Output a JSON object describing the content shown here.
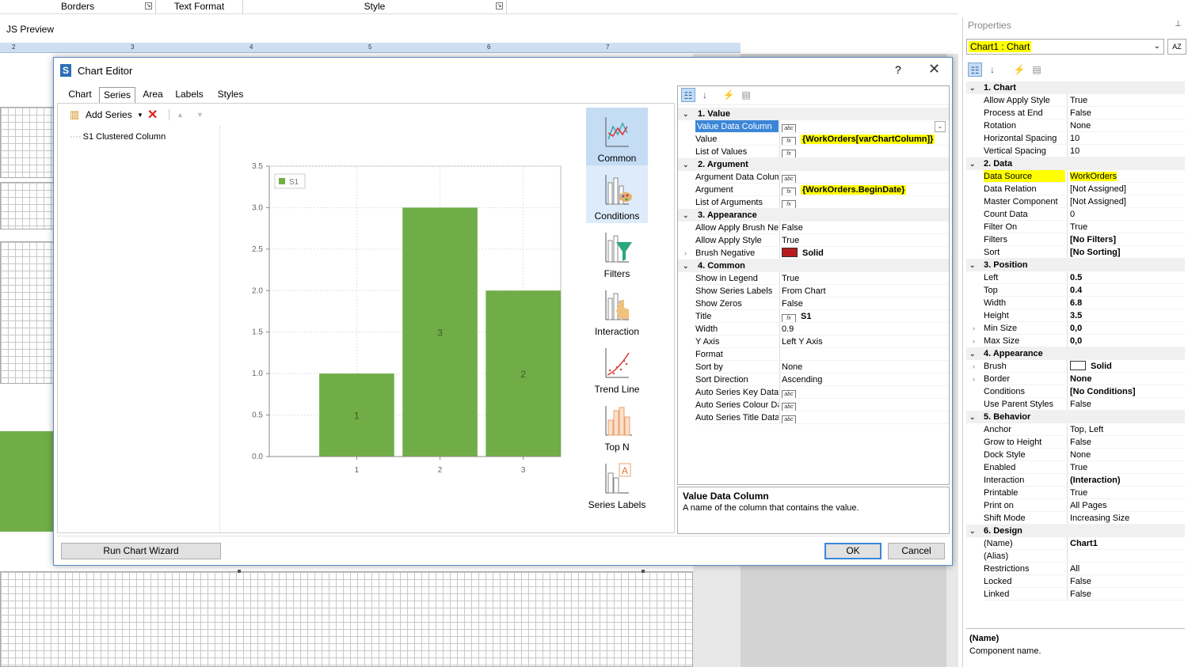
{
  "ribbon": {
    "groups": [
      {
        "label": "Borders"
      },
      {
        "label": "Text Format"
      },
      {
        "label": "Style"
      }
    ]
  },
  "preview_tab": "JS Preview",
  "ruler": {
    "ticks": [
      "2",
      "3",
      "4",
      "5",
      "6",
      "7"
    ]
  },
  "properties": {
    "title": "Properties",
    "object_selector": "Chart1 : Chart",
    "description_title": "(Name)",
    "description_text": "Component name.",
    "groups": [
      {
        "title": "1. Chart",
        "rows": [
          {
            "k": "Allow Apply Style",
            "v": "True"
          },
          {
            "k": "Process at End",
            "v": "False"
          },
          {
            "k": "Rotation",
            "v": "None"
          },
          {
            "k": "Horizontal Spacing",
            "v": "10"
          },
          {
            "k": "Vertical Spacing",
            "v": "10"
          }
        ]
      },
      {
        "title": "2. Data",
        "rows": [
          {
            "k": "Data Source",
            "v": "WorkOrders",
            "hl": true
          },
          {
            "k": "Data Relation",
            "v": "[Not Assigned]"
          },
          {
            "k": "Master Component",
            "v": "[Not Assigned]"
          },
          {
            "k": "Count Data",
            "v": "0"
          },
          {
            "k": "Filter On",
            "v": "True"
          },
          {
            "k": "Filters",
            "v": "[No Filters]",
            "b": true
          },
          {
            "k": "Sort",
            "v": "[No Sorting]",
            "b": true
          }
        ]
      },
      {
        "title": "3. Position",
        "rows": [
          {
            "k": "Left",
            "v": "0.5",
            "b": true
          },
          {
            "k": "Top",
            "v": "0.4",
            "b": true
          },
          {
            "k": "Width",
            "v": "6.8",
            "b": true
          },
          {
            "k": "Height",
            "v": "3.5",
            "b": true
          },
          {
            "k": "Min Size",
            "v": "0,0",
            "b": true,
            "ex": true
          },
          {
            "k": "Max Size",
            "v": "0,0",
            "b": true,
            "ex": true
          }
        ]
      },
      {
        "title": "4. Appearance",
        "rows": [
          {
            "k": "Brush",
            "v": "Solid",
            "b": true,
            "ex": true,
            "sw": "white"
          },
          {
            "k": "Border",
            "v": "None",
            "b": true,
            "ex": true
          },
          {
            "k": "Conditions",
            "v": "[No Conditions]",
            "b": true
          },
          {
            "k": "Use Parent Styles",
            "v": "False"
          }
        ]
      },
      {
        "title": "5. Behavior",
        "rows": [
          {
            "k": "Anchor",
            "v": "Top, Left"
          },
          {
            "k": "Grow to Height",
            "v": "False"
          },
          {
            "k": "Dock Style",
            "v": "None"
          },
          {
            "k": "Enabled",
            "v": "True"
          },
          {
            "k": "Interaction",
            "v": "(Interaction)",
            "b": true
          },
          {
            "k": "Printable",
            "v": "True"
          },
          {
            "k": "Print on",
            "v": "All Pages"
          },
          {
            "k": "Shift Mode",
            "v": "Increasing Size"
          }
        ]
      },
      {
        "title": "6. Design",
        "rows": [
          {
            "k": "(Name)",
            "v": "Chart1",
            "b": true
          },
          {
            "k": "(Alias)",
            "v": ""
          },
          {
            "k": "Restrictions",
            "v": "All"
          },
          {
            "k": "Locked",
            "v": "False"
          },
          {
            "k": "Linked",
            "v": "False"
          }
        ]
      }
    ]
  },
  "dialog": {
    "title": "Chart Editor",
    "help": "?",
    "close": "✕",
    "tabs": [
      "Chart",
      "Series",
      "Area",
      "Labels",
      "Styles"
    ],
    "active_tab": "Series",
    "add_series": "Add Series",
    "series_item": "S1 Clustered Column",
    "categories": [
      "Common",
      "Conditions",
      "Filters",
      "Interaction",
      "Trend Line",
      "Top N",
      "Series Labels"
    ],
    "run_wizard": "Run Chart Wizard",
    "ok": "OK",
    "cancel": "Cancel",
    "description_title": "Value Data Column",
    "description_text": "A name of the column that contains the value.",
    "groups": [
      {
        "title": "1. Value",
        "rows": [
          {
            "k": "Value Data Column",
            "v": "",
            "icon": "abc",
            "sel": true,
            "dd": true
          },
          {
            "k": "Value",
            "v": "{WorkOrders[varChartColumn]}",
            "icon": "fx",
            "hl": true
          },
          {
            "k": "List of Values",
            "v": "",
            "icon": "fx"
          }
        ]
      },
      {
        "title": "2. Argument",
        "rows": [
          {
            "k": "Argument Data Column",
            "v": "",
            "icon": "abc"
          },
          {
            "k": "Argument",
            "v": "{WorkOrders.BeginDate}",
            "icon": "fx",
            "hl": true
          },
          {
            "k": "List of Arguments",
            "v": "",
            "icon": "fx"
          }
        ]
      },
      {
        "title": "3. Appearance",
        "rows": [
          {
            "k": "Allow Apply Brush Negative",
            "v": "False"
          },
          {
            "k": "Allow Apply Style",
            "v": "True"
          },
          {
            "k": "Brush Negative",
            "v": "Solid",
            "sw": "red",
            "ex": true,
            "b": true
          }
        ]
      },
      {
        "title": "4. Common",
        "rows": [
          {
            "k": "Show in Legend",
            "v": "True"
          },
          {
            "k": "Show Series Labels",
            "v": "From Chart"
          },
          {
            "k": "Show Zeros",
            "v": "False"
          },
          {
            "k": "Title",
            "v": "S1",
            "icon": "fx",
            "b": true
          },
          {
            "k": "Width",
            "v": "0.9"
          },
          {
            "k": "Y Axis",
            "v": "Left Y Axis"
          },
          {
            "k": "Format",
            "v": ""
          },
          {
            "k": "Sort by",
            "v": "None"
          },
          {
            "k": "Sort Direction",
            "v": "Ascending"
          },
          {
            "k": "Auto Series Key Data Column",
            "v": "",
            "icon": "abc"
          },
          {
            "k": "Auto Series Colour Data Column",
            "v": "",
            "icon": "abc"
          },
          {
            "k": "Auto Series Title Data Column",
            "v": "",
            "icon": "abc"
          }
        ]
      }
    ]
  },
  "chart_data": {
    "type": "bar",
    "categories": [
      "1",
      "2",
      "3"
    ],
    "series": [
      {
        "name": "S1",
        "values": [
          1,
          3,
          2
        ],
        "color": "#70ad47"
      }
    ],
    "data_labels": [
      "1",
      "3",
      "2"
    ],
    "yticks": [
      "0.0",
      "0.5",
      "1.0",
      "1.5",
      "2.0",
      "2.5",
      "3.0",
      "3.5"
    ],
    "ylim": [
      0,
      3.5
    ],
    "legend": "top-left",
    "grid": true,
    "title": "",
    "xlabel": "",
    "ylabel": ""
  }
}
